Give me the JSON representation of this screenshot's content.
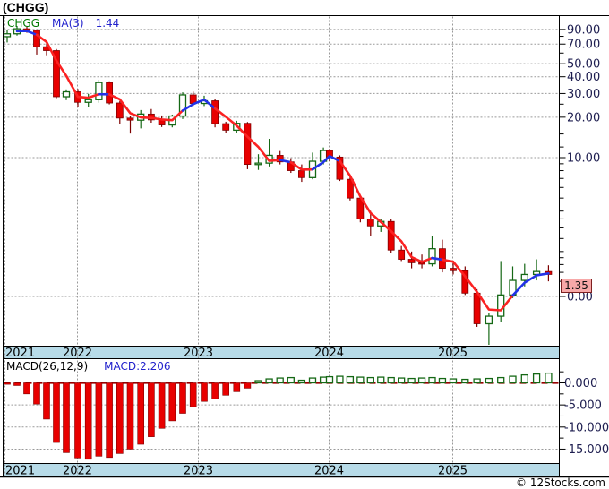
{
  "header": {
    "title": "(CHGG)"
  },
  "main_chart": {
    "legend": {
      "symbol": "CHGG",
      "ma_label": "MA(3)",
      "ma_value": "1.44"
    },
    "y_axis_labels": [
      "90.00",
      "70.00",
      "50.00",
      "40.00",
      "30.00",
      "20.00",
      "10.00"
    ],
    "zero_label": "0.00",
    "price_tag": "1.35"
  },
  "macd_chart": {
    "legend": {
      "name": "MACD(26,12,9)",
      "value_label": "MACD:2.206"
    },
    "y_axis_labels": [
      "0.000",
      "-5.000",
      "-10.000",
      "-15.000"
    ]
  },
  "x_axis": {
    "years": [
      "2021",
      "2022",
      "2023",
      "2024",
      "2025"
    ]
  },
  "footer": {
    "copyright": "© 12Stocks.com"
  },
  "colors": {
    "candle_up_stroke": "#156815",
    "candle_down_fill": "#e80000",
    "candle_down_stroke": "#7d0000",
    "ma_up": "#2233e8",
    "ma_down": "#fb2222",
    "grid": "#999999",
    "axis_text": "#1d1d4f",
    "year_bar_bg": "#b7dbe8",
    "macd_zero_line": "#990000",
    "price_tag_bg": "#f7a8a8",
    "legend_symbol": "#007a00",
    "legend_blue": "#2222cc"
  },
  "chart_data": [
    {
      "type": "candlestick",
      "title": "CHGG monthly price with MA(3) overlay",
      "scale": "log",
      "yticks": [
        90,
        70,
        50,
        40,
        30,
        20,
        10
      ],
      "minor_yticks": [
        80,
        60,
        25,
        15,
        12,
        9,
        8,
        7,
        6,
        5,
        4,
        3.5,
        3,
        2.5,
        2,
        1.8,
        1.6,
        1.4,
        1.2
      ],
      "zero_line_value": 0,
      "last_price": 1.35,
      "ma_period": 3,
      "months_per_year": [
        7,
        12,
        12,
        12,
        9
      ],
      "months": [
        "2021-06",
        "2021-07",
        "2021-08",
        "2021-09",
        "2021-10",
        "2021-11",
        "2021-12",
        "2022-01",
        "2022-02",
        "2022-03",
        "2022-04",
        "2022-05",
        "2022-06",
        "2022-07",
        "2022-08",
        "2022-09",
        "2022-10",
        "2022-11",
        "2022-12",
        "2023-01",
        "2023-02",
        "2023-03",
        "2023-04",
        "2023-05",
        "2023-06",
        "2023-07",
        "2023-08",
        "2023-09",
        "2023-10",
        "2023-11",
        "2023-12",
        "2024-01",
        "2024-02",
        "2024-03",
        "2024-04",
        "2024-05",
        "2024-06",
        "2024-07",
        "2024-08",
        "2024-09",
        "2024-10",
        "2024-11",
        "2024-12",
        "2025-01",
        "2025-02",
        "2025-03",
        "2025-04",
        "2025-05",
        "2025-06",
        "2025-07",
        "2025-08",
        "2025-09"
      ],
      "ohlc": [
        [
          79.5,
          89.0,
          72.0,
          83.5
        ],
        [
          83.5,
          95.5,
          81.0,
          91.0
        ],
        [
          91.0,
          94.0,
          85.0,
          88.5
        ],
        [
          88.5,
          90.0,
          58.5,
          66.9
        ],
        [
          66.9,
          71.0,
          57.8,
          62.6
        ],
        [
          62.6,
          64.3,
          27.7,
          28.4
        ],
        [
          28.4,
          32.2,
          26.8,
          30.9
        ],
        [
          30.9,
          32.4,
          23.8,
          25.8
        ],
        [
          25.8,
          29.8,
          23.9,
          27.0
        ],
        [
          27.0,
          37.9,
          25.6,
          36.2
        ],
        [
          36.2,
          37.0,
          24.9,
          25.5
        ],
        [
          25.5,
          26.3,
          17.7,
          19.7
        ],
        [
          19.7,
          20.3,
          15.1,
          19.0
        ],
        [
          19.0,
          22.6,
          16.5,
          21.1
        ],
        [
          21.1,
          23.0,
          18.2,
          19.1
        ],
        [
          19.1,
          20.6,
          16.9,
          17.5
        ],
        [
          17.5,
          20.9,
          16.8,
          20.4
        ],
        [
          20.4,
          30.6,
          19.4,
          29.3
        ],
        [
          29.3,
          31.0,
          24.3,
          25.3
        ],
        [
          25.3,
          28.9,
          24.2,
          26.5
        ],
        [
          26.5,
          27.2,
          16.8,
          17.9
        ],
        [
          17.9,
          18.5,
          15.2,
          16.0
        ],
        [
          16.0,
          18.8,
          15.3,
          18.0
        ],
        [
          18.0,
          18.4,
          8.2,
          8.9
        ],
        [
          8.9,
          10.6,
          8.1,
          9.1
        ],
        [
          9.1,
          13.8,
          8.6,
          10.4
        ],
        [
          10.4,
          11.2,
          8.9,
          9.3
        ],
        [
          9.3,
          9.9,
          7.7,
          8.0
        ],
        [
          8.0,
          8.9,
          6.6,
          7.1
        ],
        [
          7.1,
          10.9,
          6.9,
          9.4
        ],
        [
          9.4,
          11.9,
          8.9,
          11.3
        ],
        [
          11.3,
          11.6,
          9.4,
          10.1
        ],
        [
          10.1,
          10.4,
          6.7,
          6.9
        ],
        [
          6.9,
          7.5,
          4.8,
          5.0
        ],
        [
          5.0,
          5.2,
          3.3,
          3.5
        ],
        [
          3.5,
          4.0,
          2.6,
          3.1
        ],
        [
          3.1,
          3.5,
          2.8,
          3.35
        ],
        [
          3.35,
          3.5,
          1.95,
          2.05
        ],
        [
          2.05,
          2.2,
          1.7,
          1.75
        ],
        [
          1.75,
          2.0,
          1.5,
          1.65
        ],
        [
          1.65,
          1.9,
          1.5,
          1.62
        ],
        [
          1.62,
          2.6,
          1.55,
          2.1
        ],
        [
          2.1,
          2.45,
          1.4,
          1.5
        ],
        [
          1.5,
          1.65,
          1.35,
          1.44
        ],
        [
          1.44,
          1.55,
          0.95,
          0.98
        ],
        [
          0.98,
          1.05,
          0.55,
          0.58
        ],
        [
          0.58,
          0.7,
          0.4,
          0.66
        ],
        [
          0.66,
          1.7,
          0.6,
          0.95
        ],
        [
          0.95,
          1.55,
          0.9,
          1.22
        ],
        [
          1.22,
          1.62,
          1.1,
          1.35
        ],
        [
          1.35,
          1.75,
          1.22,
          1.42
        ],
        [
          1.42,
          1.58,
          1.2,
          1.35
        ]
      ]
    },
    {
      "type": "bar",
      "title": "MACD(26,12,9)",
      "yticks": [
        0,
        -5,
        -10,
        -15
      ],
      "minor_yticks": [
        2.5,
        -2.5,
        -7.5,
        -12.5
      ],
      "last_value": 2.206,
      "values": [
        -0.2,
        -0.6,
        -2.5,
        -4.8,
        -8.2,
        -13.5,
        -15.8,
        -17.0,
        -17.3,
        -16.6,
        -16.9,
        -16.0,
        -15.0,
        -13.9,
        -12.2,
        -10.3,
        -8.6,
        -6.9,
        -5.4,
        -4.2,
        -3.6,
        -2.8,
        -2.0,
        -1.2,
        0.5,
        0.9,
        1.1,
        1.2,
        0.6,
        1.1,
        1.3,
        1.4,
        1.5,
        1.4,
        1.3,
        1.2,
        1.3,
        1.2,
        1.1,
        1.0,
        1.1,
        1.2,
        1.0,
        0.9,
        0.8,
        0.9,
        1.0,
        1.2,
        1.5,
        1.8,
        2.0,
        2.206
      ]
    }
  ]
}
